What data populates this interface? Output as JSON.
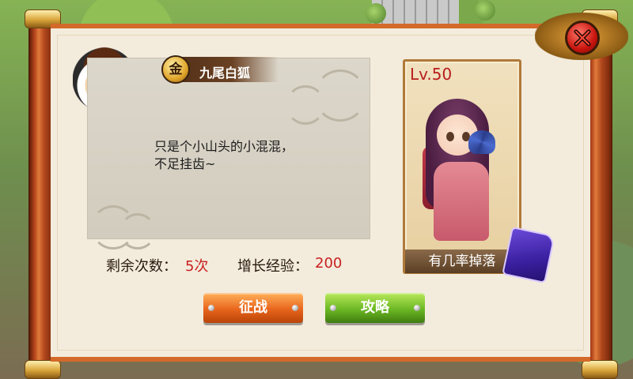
{
  "npc": {
    "name": "九尾白狐",
    "grade_badge": "金",
    "dialog": "只是个小山头的小混混，\n不足挂齿~"
  },
  "stats": {
    "remaining_label": "剩余次数：",
    "remaining_value": "5次",
    "exp_label": "增长经验：",
    "exp_value": "200"
  },
  "buttons": {
    "fight": "征战",
    "guide": "攻略"
  },
  "card": {
    "level": "Lv.50",
    "drop_label": "有几率掉落"
  },
  "colors": {
    "accent_red": "#c82020",
    "fight_button": "#e8651c",
    "guide_button": "#6cb824",
    "panel_bg": "#f3ecdd"
  }
}
